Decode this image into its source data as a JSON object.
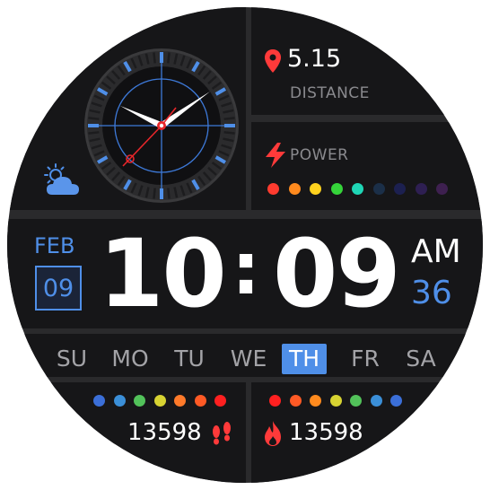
{
  "distance": {
    "value": "5.15",
    "label": "DISTANCE"
  },
  "power": {
    "label": "POWER",
    "dot_colors": [
      "#ff3b2f",
      "#ff8a1e",
      "#ffd21e",
      "#35d43a",
      "#1fd6b6",
      "#1b2f48",
      "#1c2050",
      "#2e1f52",
      "#3e2050"
    ]
  },
  "date": {
    "month": "FEB",
    "day": "09"
  },
  "time": {
    "hours": "10",
    "separator": ":",
    "minutes": "09",
    "ampm": "AM",
    "seconds": "36"
  },
  "weekdays": [
    {
      "label": "SU",
      "active": false
    },
    {
      "label": "MO",
      "active": false
    },
    {
      "label": "TU",
      "active": false
    },
    {
      "label": "WE",
      "active": false
    },
    {
      "label": "TH",
      "active": true
    },
    {
      "label": "FR",
      "active": false
    },
    {
      "label": "SA",
      "active": false
    }
  ],
  "steps": {
    "value": "13598",
    "dot_colors": [
      "#3b6fd8",
      "#3b8fd8",
      "#52c25a",
      "#d7d332",
      "#ff7a2a",
      "#ff5a25",
      "#ff2020"
    ]
  },
  "calories": {
    "value": "13598",
    "dot_colors": [
      "#ff2020",
      "#ff5a25",
      "#ff8a1e",
      "#d7d332",
      "#52c25a",
      "#3b8fd8",
      "#3b6fd8"
    ]
  },
  "colors": {
    "accent": "#4f8fe8",
    "red": "#ff3a3a",
    "background": "#161618",
    "divider": "#2a2a2c"
  },
  "icons": {
    "weather": "partly-cloudy-icon",
    "location": "location-pin-icon",
    "power": "lightning-icon",
    "steps": "footprints-icon",
    "calories": "flame-icon"
  }
}
